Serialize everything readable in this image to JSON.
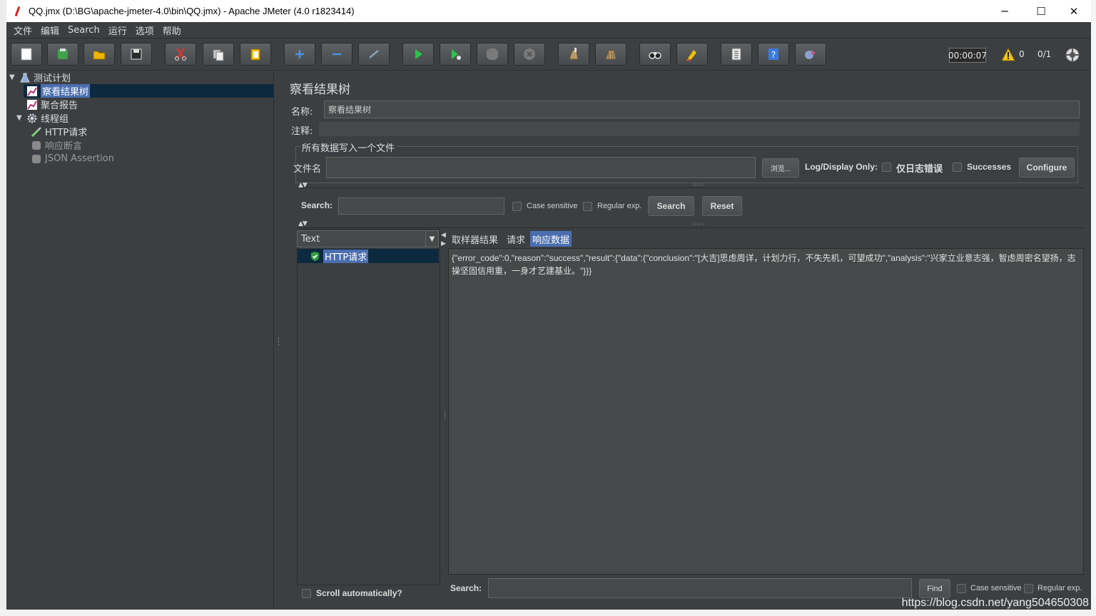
{
  "window": {
    "title": "QQ.jmx (D:\\BG\\apache-jmeter-4.0\\bin\\QQ.jmx) - Apache JMeter (4.0 r1823414)",
    "minimize": "─",
    "maximize": "☐",
    "close": "✕"
  },
  "menu": [
    "文件",
    "编辑",
    "Search",
    "运行",
    "选项",
    "帮助"
  ],
  "toolbar": {
    "buttons": [
      {
        "name": "new-icon",
        "color": "#ffffff"
      },
      {
        "name": "templates-icon",
        "color": "#3fa34d"
      },
      {
        "name": "open-icon",
        "color": "#f0b400"
      },
      {
        "name": "save-icon",
        "color": "#dcdcdc"
      },
      {
        "name": "cut-icon",
        "color": "#e03030"
      },
      {
        "name": "copy-icon",
        "color": "#dcdcdc"
      },
      {
        "name": "paste-icon",
        "color": "#f0c000"
      },
      {
        "name": "expand-icon",
        "color": "#4a90e2"
      },
      {
        "name": "collapse-icon",
        "color": "#4a90e2"
      },
      {
        "name": "toggle-icon",
        "color": "#8aa0b0"
      },
      {
        "name": "start-icon",
        "color": "#2ec24a"
      },
      {
        "name": "start-no-pauses-icon",
        "color": "#2ec24a"
      },
      {
        "name": "stop-icon",
        "color": "#8a8a8a"
      },
      {
        "name": "shutdown-icon",
        "color": "#8a8a8a"
      },
      {
        "name": "clear-icon",
        "color": "#b89a6a"
      },
      {
        "name": "clear-all-icon",
        "color": "#b89a6a"
      },
      {
        "name": "search-icon",
        "color": "#dcdcdc"
      },
      {
        "name": "reset-search-icon",
        "color": "#f0c000"
      },
      {
        "name": "function-helper-icon",
        "color": "#dcdcdc"
      },
      {
        "name": "help-icon",
        "color": "#3a7be0"
      },
      {
        "name": "remote-start-icon",
        "color": "#c06080"
      }
    ],
    "timer": "00:00:07",
    "warnings": "0",
    "threads": "0/1"
  },
  "tree": {
    "root": "测试计划",
    "items": [
      {
        "label": "察看结果树",
        "selected": true
      },
      {
        "label": "聚合报告"
      },
      {
        "label": "线程组"
      },
      {
        "label": "HTTP请求"
      },
      {
        "label": "响应断言",
        "disabled": true
      },
      {
        "label": "JSON Assertion",
        "disabled": true
      }
    ]
  },
  "panel": {
    "title": "察看结果树",
    "name_label": "名称:",
    "name_value": "察看结果树",
    "comment_label": "注释:",
    "file_box_title": "所有数据写入一个文件",
    "filename_label": "文件名",
    "browse_label": "浏览...",
    "log_display_label": "Log/Display Only:",
    "errors_label": "仅日志错误",
    "successes_label": "Successes",
    "configure_label": "Configure"
  },
  "search": {
    "label": "Search:",
    "case_sensitive": "Case sensitive",
    "regular_exp": "Regular exp.",
    "search_button": "Search",
    "reset_button": "Reset"
  },
  "results": {
    "renderer": "Text",
    "renderer_arrow": "▼",
    "items": [
      {
        "label": "HTTP请求",
        "status": "success"
      }
    ],
    "scroll_auto": "Scroll automatically?",
    "tabs": [
      "取样器结果",
      "请求",
      "响应数据"
    ],
    "active_tab": 2,
    "response_text": "{\"error_code\":0,\"reason\":\"success\",\"result\":{\"data\":{\"conclusion\":\"[大吉]思虑周详，计划力行，不失先机，可望成功\",\"analysis\":\"兴家立业意志强，智虑周密名望扬，志操坚固信用重，一身才艺建基业。\"}}}",
    "bottom_search_label": "Search:",
    "find_button": "Find",
    "case_sensitive": "Case sensitive",
    "regular_exp": "Regular exp."
  },
  "watermark": "https://blog.csdn.net/yang504650308",
  "colors": {
    "background": "#3c3f41",
    "selection": "#4b6eaf",
    "field": "#45494a"
  }
}
